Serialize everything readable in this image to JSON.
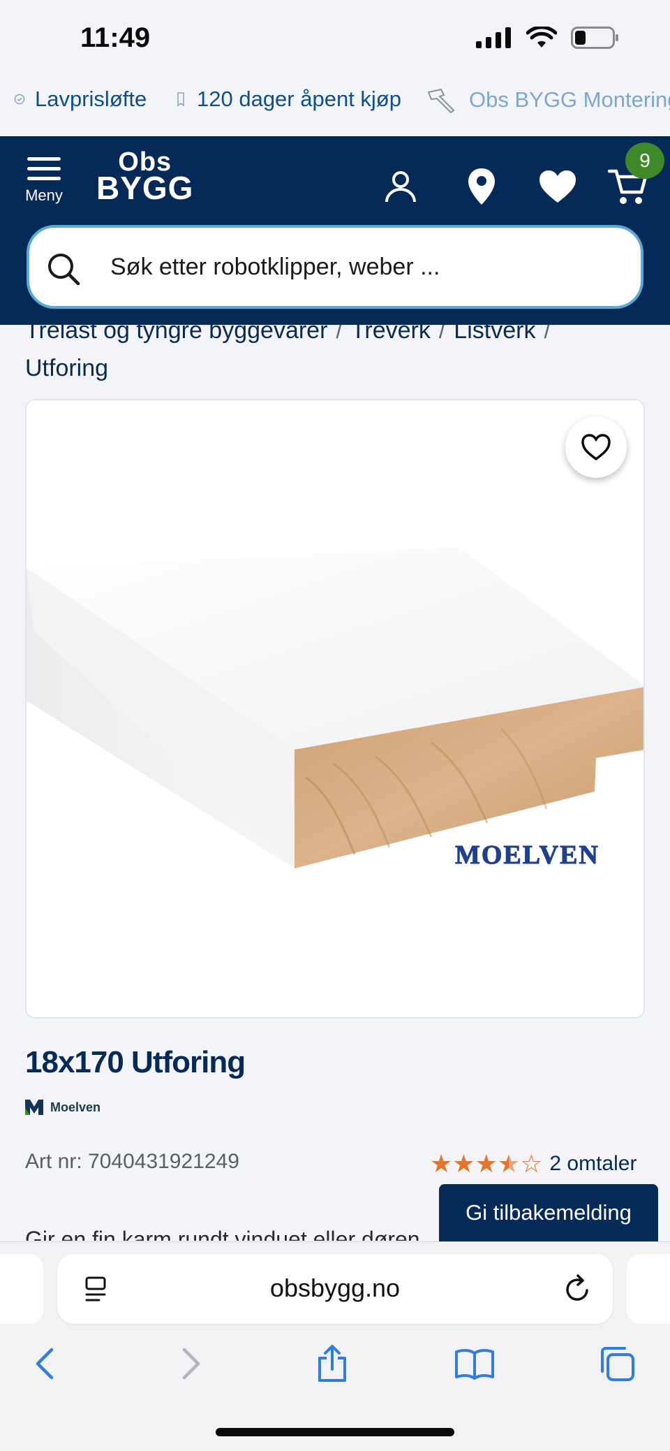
{
  "status_bar": {
    "time": "11:49"
  },
  "usp": {
    "items": [
      {
        "label": "Lavprisløfte",
        "icon": "check-circle-icon"
      },
      {
        "label": "120 dager åpent kjøp",
        "icon": "receipt-icon"
      },
      {
        "label": "Obs BYGG Montering",
        "icon": "hammer-icon"
      }
    ]
  },
  "header": {
    "menu_label": "Meny",
    "logo_top": "Obs",
    "logo_bottom": "BYGG",
    "cart_count": "9",
    "search_placeholder": "Søk etter robotklipper, weber ..."
  },
  "breadcrumb": {
    "items": [
      "Trelast og tyngre byggevarer",
      "Treverk",
      "Listverk",
      "Utforing"
    ]
  },
  "product": {
    "image_brand_mark": "MOELVEN",
    "title": "18x170 Utforing",
    "brand": "Moelven",
    "art_nr": "Art nr: 7040431921249",
    "rating": 3.5,
    "rating_max": 5,
    "reviews": "2 omtaler",
    "description": "Gir en fin karm rundt vinduet eller døren"
  },
  "feedback_button": "Gi tilbakemelding",
  "browser": {
    "url": "obsbygg.no"
  },
  "colors": {
    "brand_navy": "#062a57",
    "link_blue": "#0f4e8a",
    "badge_green": "#3e8a2b",
    "star_orange": "#e8732a"
  }
}
